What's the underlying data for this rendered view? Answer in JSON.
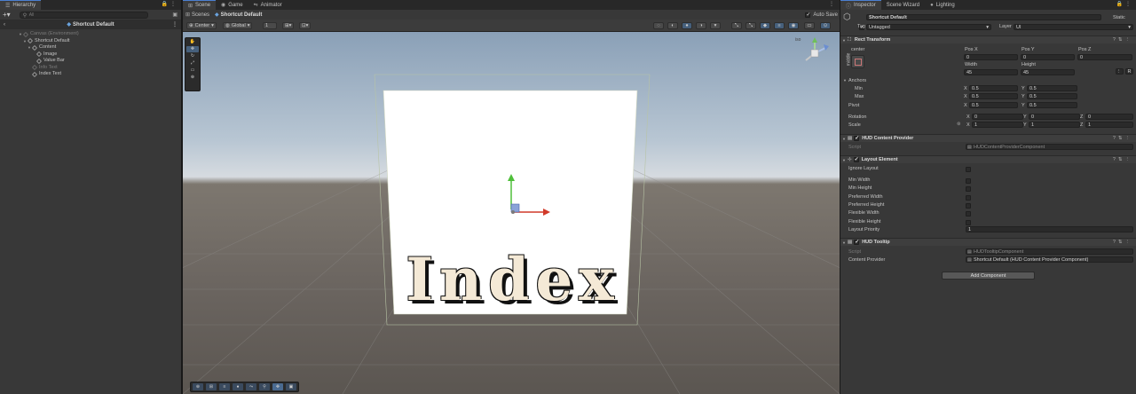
{
  "hierarchy": {
    "tab": "Hierarchy",
    "search_placeholder": "All",
    "header_title": "Shortcut Default",
    "items": [
      {
        "label": "Canvas (Environment)",
        "dim": true,
        "depth": 1,
        "arrow": "▼"
      },
      {
        "label": "Shortcut Default",
        "dim": false,
        "depth": 2,
        "arrow": "▼"
      },
      {
        "label": "Content",
        "dim": false,
        "depth": 3,
        "arrow": "▼"
      },
      {
        "label": "Image",
        "dim": false,
        "depth": 4,
        "arrow": ""
      },
      {
        "label": "Value Bar",
        "dim": false,
        "depth": 4,
        "arrow": ""
      },
      {
        "label": "Info Text",
        "dim": true,
        "depth": 3,
        "arrow": ""
      },
      {
        "label": "Index Text",
        "dim": false,
        "depth": 3,
        "arrow": ""
      }
    ]
  },
  "scene": {
    "tabs": [
      "Scene",
      "Game",
      "Animator"
    ],
    "breadcrumb_root": "Scenes",
    "breadcrumb_current": "Shortcut Default",
    "auto_save_label": "Auto Save",
    "pivot_mode": "Center",
    "space_mode": "Global",
    "snap_value": "1",
    "view_label": "Index"
  },
  "inspector": {
    "tabs": [
      "Inspector",
      "Scene Wizard",
      "Lighting"
    ],
    "object_name": "Shortcut Default",
    "static_label": "Static",
    "tag_label": "Tag",
    "tag_value": "Untagged",
    "layer_label": "Layer",
    "layer_value": "UI",
    "rect_transform": {
      "title": "Rect Transform",
      "anchor_preset": "center",
      "side_label": "middle",
      "posx_label": "Pos X",
      "posy_label": "Pos Y",
      "posz_label": "Pos Z",
      "posx": "0",
      "posy": "0",
      "posz": "0",
      "width_label": "Width",
      "height_label": "Height",
      "width": "45",
      "height": "45",
      "anchors_label": "Anchors",
      "min_label": "Min",
      "max_label": "Max",
      "pivot_label": "Pivot",
      "min_x": "0.5",
      "min_y": "0.5",
      "max_x": "0.5",
      "max_y": "0.5",
      "pivot_x": "0.5",
      "pivot_y": "0.5",
      "rotation_label": "Rotation",
      "scale_label": "Scale",
      "rot_x": "0",
      "rot_y": "0",
      "rot_z": "0",
      "scale_x": "1",
      "scale_y": "1",
      "scale_z": "1",
      "x_label": "X",
      "y_label": "Y",
      "z_label": "Z",
      "r_button": "R"
    },
    "hud_content_provider": {
      "title": "HUD Content Provider",
      "script_label": "Script",
      "script_value": "HUDContentProviderComponent"
    },
    "layout_element": {
      "title": "Layout Element",
      "rows": [
        "Ignore Layout",
        "Min Width",
        "Min Height",
        "Preferred Width",
        "Preferred Height",
        "Flexible Width",
        "Flexible Height"
      ],
      "priority_label": "Layout Priority",
      "priority_value": "1"
    },
    "hud_tooltip": {
      "title": "HUD Tooltip",
      "script_label": "Script",
      "script_value": "HUDTooltipComponent",
      "provider_label": "Content Provider",
      "provider_value": "Shortcut Default (HUD Content Provider Component)"
    },
    "add_component_label": "Add Component"
  }
}
